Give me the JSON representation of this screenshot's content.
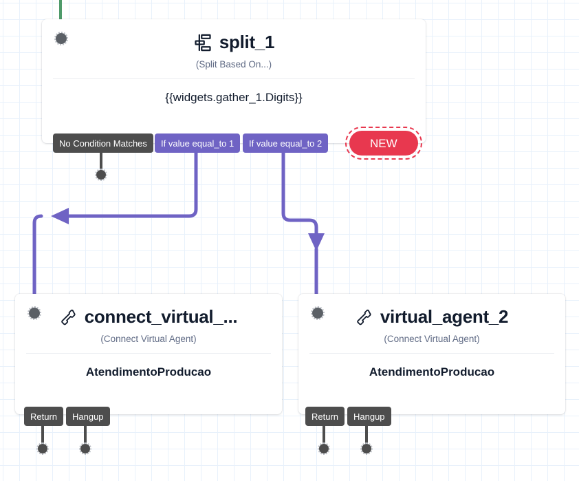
{
  "canvas": {
    "background": "#ffffff",
    "grid_color": "#e8f1fb",
    "accent_purple": "#6f63c4",
    "accent_red": "#e8384f",
    "accent_dark": "#4d4d4d",
    "accent_green": "#4e9a6a"
  },
  "nodes": {
    "split": {
      "title": "split_1",
      "subtitle": "(Split Based On...)",
      "body": "{{widgets.gather_1.Digits}}",
      "icon": "split-icon",
      "transitions": [
        {
          "label": "No Condition Matches",
          "style": "dark"
        },
        {
          "label": "If value equal_to 1",
          "style": "purple"
        },
        {
          "label": "If value equal_to 2",
          "style": "purple"
        }
      ],
      "new_button": "NEW"
    },
    "connect_virtual": {
      "title": "connect_virtual_...",
      "subtitle": "(Connect Virtual Agent)",
      "body": "AtendimentoProducao",
      "icon": "phone-icon",
      "transitions": [
        {
          "label": "Return",
          "style": "dark"
        },
        {
          "label": "Hangup",
          "style": "dark"
        }
      ]
    },
    "virtual_agent_2": {
      "title": "virtual_agent_2",
      "subtitle": "(Connect Virtual Agent)",
      "body": "AtendimentoProducao",
      "icon": "phone-icon",
      "transitions": [
        {
          "label": "Return",
          "style": "dark"
        },
        {
          "label": "Hangup",
          "style": "dark"
        }
      ]
    }
  }
}
